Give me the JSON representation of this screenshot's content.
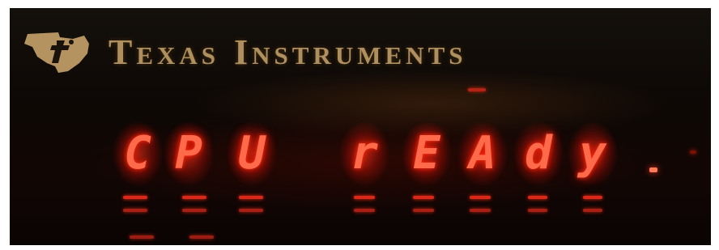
{
  "brand": {
    "logo_icon": "texas-instruments-logo-icon",
    "name_word1": "Texas",
    "name_word2": "Instruments",
    "text_color": "#c7a26a"
  },
  "display": {
    "message_word1": "CPU",
    "message_word2": "rEAdy",
    "characters": [
      "C",
      "P",
      "U",
      "r",
      "E",
      "A",
      "d",
      "y"
    ],
    "led_color": "#ff3a20"
  }
}
